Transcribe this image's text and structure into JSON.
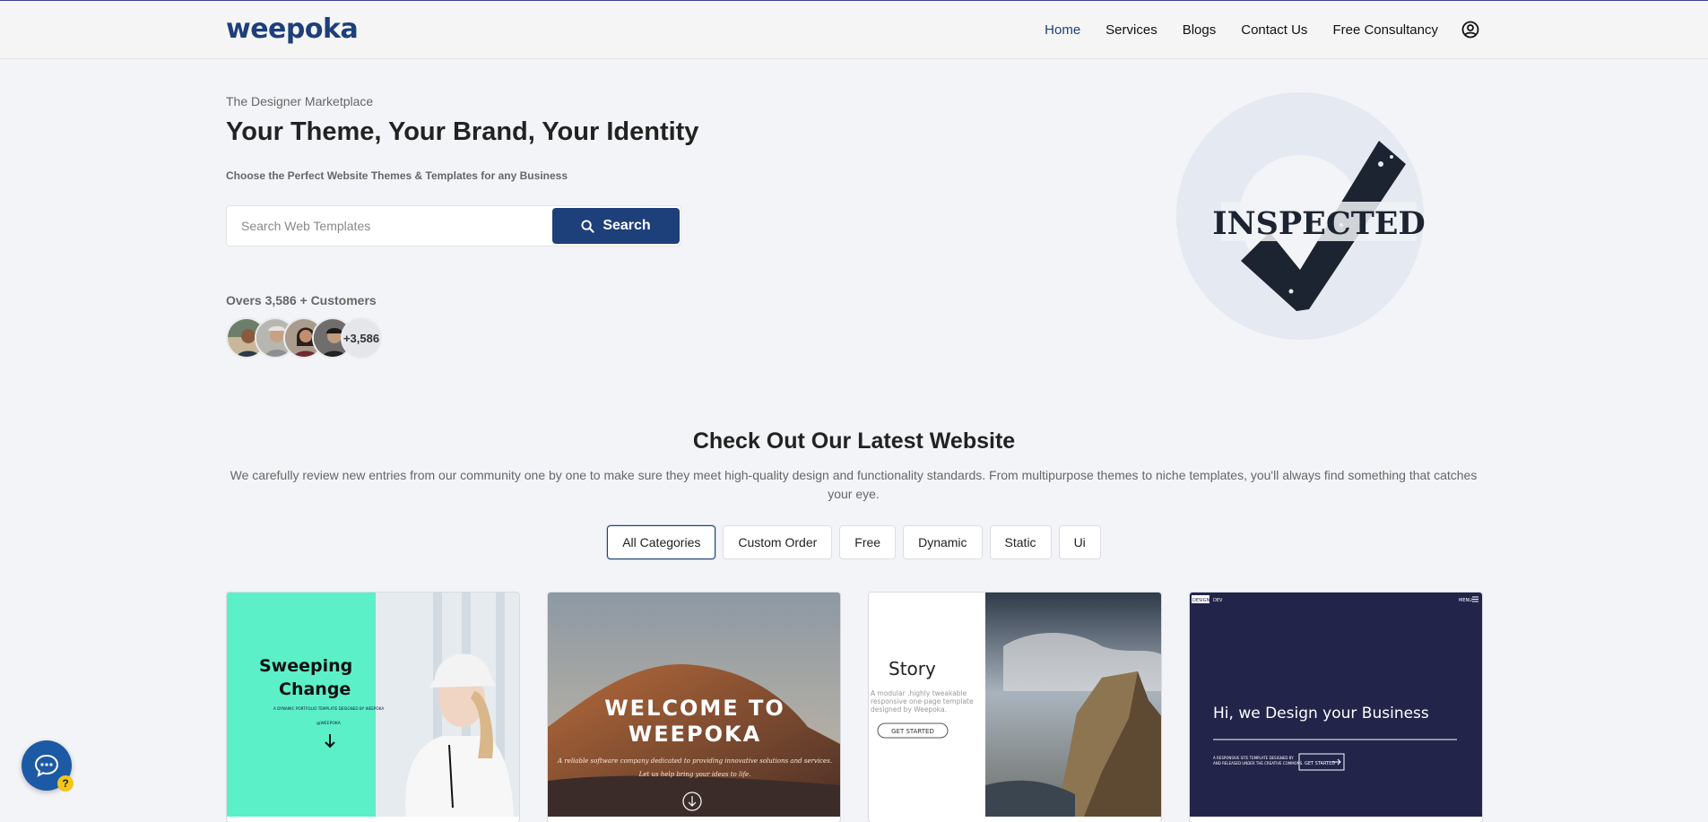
{
  "brand": {
    "logo_text": "weepoka",
    "accent": "#1d3f7a"
  },
  "nav": {
    "items": [
      {
        "label": "Home",
        "active": true
      },
      {
        "label": "Services",
        "active": false
      },
      {
        "label": "Blogs",
        "active": false
      },
      {
        "label": "Contact Us",
        "active": false
      },
      {
        "label": "Free Consultancy",
        "active": false
      }
    ],
    "user_icon": "user-circle-icon"
  },
  "hero": {
    "tagline": "The Designer Marketplace",
    "title": "Your Theme, Your Brand, Your Identity",
    "subtitle": "Choose the Perfect Website Themes & Templates for any Business",
    "search": {
      "placeholder": "Search Web Templates",
      "value": "",
      "button_label": "Search",
      "icon": "search-icon"
    },
    "customers_label": "Overs 3,586 + Customers",
    "avatar_more": "+3,586",
    "badge_text": "INSPECTED"
  },
  "latest": {
    "title": "Check Out Our Latest Website",
    "description": "We carefully review new entries from our community one by one to make sure they meet high-quality design and functionality standards. From multipurpose themes to niche templates, you'll always find something that catches your eye.",
    "filters": [
      {
        "label": "All Categories",
        "active": true
      },
      {
        "label": "Custom Order",
        "active": false
      },
      {
        "label": "Free",
        "active": false
      },
      {
        "label": "Dynamic",
        "active": false
      },
      {
        "label": "Static",
        "active": false
      },
      {
        "label": "Ui",
        "active": false
      }
    ]
  },
  "cards": [
    {
      "title": "Sweeping Change",
      "small_text": "A DYNAMIC PORTFOLIO TEMPLATE DESIGNED BY WEEPOKA",
      "brand_line": "@WEEPOKA",
      "bg": "#5cf0c8"
    },
    {
      "title": "WELCOME TO WEEPOKA",
      "line1": "A reliable software company dedicated to providing innovative solutions and services.",
      "line2": "Let us help bring your ideas to life."
    },
    {
      "title": "Story",
      "description": "A modular, highly tweakable responsive one-page template designed by Weepoka.",
      "button": "GET STARTED"
    },
    {
      "brand": "DESIGN",
      "brand_suffix": "DEV",
      "menu": "MENU",
      "title": "Hi, we Design your Business",
      "small_text": "A RESPONSIVE SITE TEMPLATE DESIGNED BY WEEPOKA AND RELEASED UNDER THE CREATIVE COMMONS",
      "button": "GET STARTED",
      "bg": "#22244a"
    }
  ],
  "chat": {
    "icon": "chat-bubble-icon",
    "help_badge": "?"
  }
}
